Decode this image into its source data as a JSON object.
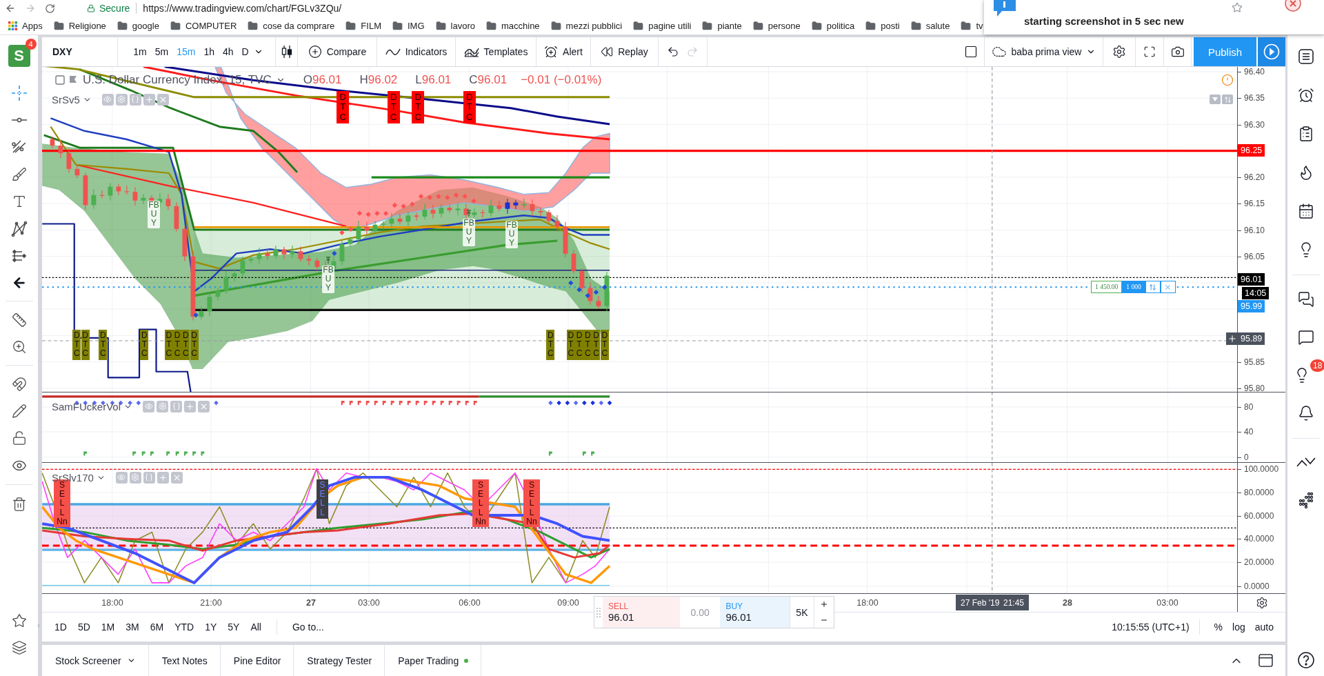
{
  "browser": {
    "secure_label": "Secure",
    "url": "https://www.tradingview.com/chart/FGLv3ZQu/",
    "bookmarks": [
      {
        "label": "Apps",
        "kind": "apps"
      },
      {
        "label": "Religione",
        "kind": "folder"
      },
      {
        "label": "google",
        "kind": "folder"
      },
      {
        "label": "COMPUTER",
        "kind": "folder"
      },
      {
        "label": "cose da comprare",
        "kind": "folder"
      },
      {
        "label": "FILM",
        "kind": "folder"
      },
      {
        "label": "IMG",
        "kind": "folder"
      },
      {
        "label": "lavoro",
        "kind": "folder"
      },
      {
        "label": "macchine",
        "kind": "folder"
      },
      {
        "label": "mezzi pubblici",
        "kind": "folder"
      },
      {
        "label": "pagine utili",
        "kind": "folder"
      },
      {
        "label": "piante",
        "kind": "folder"
      },
      {
        "label": "persone",
        "kind": "folder"
      },
      {
        "label": "politica",
        "kind": "folder"
      },
      {
        "label": "posti",
        "kind": "folder"
      },
      {
        "label": "salute",
        "kind": "folder"
      },
      {
        "label": "tv",
        "kind": "folder"
      }
    ]
  },
  "notification": {
    "text": "starting screenshot in 5 sec new"
  },
  "header": {
    "logo": {
      "letter": "S",
      "badge": "4"
    },
    "symbol": "DXY",
    "intervals": [
      {
        "label": "1m",
        "selected": false
      },
      {
        "label": "5m",
        "selected": false
      },
      {
        "label": "15m",
        "selected": true
      },
      {
        "label": "1h",
        "selected": false
      },
      {
        "label": "4h",
        "selected": false
      },
      {
        "label": "D",
        "selected": false
      }
    ],
    "tools": [
      {
        "label": "Compare",
        "kind": "compare"
      },
      {
        "label": "Indicators",
        "kind": "indicators"
      },
      {
        "label": "Templates",
        "kind": "templates"
      },
      {
        "label": "Alert",
        "kind": "alert"
      },
      {
        "label": "Replay",
        "kind": "replay"
      }
    ],
    "layout_name": "baba prima view",
    "publish": "Publish"
  },
  "main_pane": {
    "title": "U.S. Dollar Currency Index, 15, TVC",
    "ohlc": [
      {
        "key": "O",
        "value": "96.01"
      },
      {
        "key": "H",
        "value": "96.02"
      },
      {
        "key": "L",
        "value": "96.01"
      },
      {
        "key": "C",
        "value": "96.01"
      }
    ],
    "change": "−0.01 (−0.01%)",
    "study": "SrSv5",
    "scale": [
      "96.40",
      "96.35",
      "96.30",
      "96.20",
      "96.15",
      "96.10",
      "96.05",
      "95.85",
      "95.80"
    ],
    "price_tags": [
      {
        "label": "96.25",
        "kind": "level"
      },
      {
        "label": "96.01",
        "kind": "last"
      },
      {
        "label": "14:05",
        "kind": "countdown"
      },
      {
        "label": "95.99",
        "kind": "bid"
      },
      {
        "label": "95.89",
        "kind": "crosshair"
      }
    ],
    "position": {
      "price": "1 450.00",
      "quantity": "1 000"
    },
    "markers": [
      {
        "label": "DTC",
        "kind": "above"
      },
      {
        "label": "DTC",
        "kind": "above"
      },
      {
        "label": "DTC",
        "kind": "above"
      },
      {
        "label": "DTC",
        "kind": "above"
      },
      {
        "label": "DTC",
        "kind": "below"
      },
      {
        "label": "DTC",
        "kind": "below"
      },
      {
        "label": "DTC",
        "kind": "below"
      },
      {
        "label": "DTC",
        "kind": "below"
      },
      {
        "label": "DTC",
        "kind": "below"
      },
      {
        "label": "DTC",
        "kind": "below"
      },
      {
        "label": "DTC",
        "kind": "below"
      },
      {
        "label": "DTC",
        "kind": "below"
      },
      {
        "label": "DTC",
        "kind": "below"
      },
      {
        "label": "DTC",
        "kind": "below"
      },
      {
        "label": "DTC",
        "kind": "below"
      },
      {
        "label": "DTC",
        "kind": "below"
      },
      {
        "label": "DTC",
        "kind": "below"
      },
      {
        "label": "DTC",
        "kind": "below"
      }
    ],
    "buy_labels": [
      {
        "label": "FBUY",
        "arrow": false
      },
      {
        "label": "FBUY",
        "arrow": true
      },
      {
        "label": "FBUY",
        "arrow": true
      },
      {
        "label": "FBUY",
        "arrow": false
      }
    ]
  },
  "volume_pane": {
    "study": "SamFUckerVol",
    "scale": [
      "80",
      "40",
      "0"
    ]
  },
  "oscillator_pane": {
    "study": "SrSlv170",
    "scale": [
      "100.0000",
      "80.0000",
      "60.0000",
      "40.0000",
      "20.0000",
      "0.0000"
    ],
    "markers": [
      {
        "label": "SELL",
        "note": "Nn",
        "kind": "primary"
      },
      {
        "label": "SELL",
        "kind": "secondary"
      },
      {
        "label": "SELL",
        "note": "Nn",
        "kind": "primary"
      },
      {
        "label": "SELL",
        "note": "Nn",
        "kind": "primary"
      }
    ]
  },
  "time_axis": {
    "labels": [
      {
        "label": "18:00",
        "kind": "time"
      },
      {
        "label": "21:00",
        "kind": "time"
      },
      {
        "label": "27",
        "kind": "day"
      },
      {
        "label": "03:00",
        "kind": "time"
      },
      {
        "label": "06:00",
        "kind": "time"
      },
      {
        "label": "09:00",
        "kind": "time"
      },
      {
        "label": "18:00",
        "kind": "time"
      },
      {
        "label": "28",
        "kind": "day"
      },
      {
        "label": "03:00",
        "kind": "time"
      }
    ],
    "crosshair": {
      "date": "27 Feb '19",
      "time": "21:45"
    }
  },
  "order_panel": {
    "sell": {
      "label": "SELL",
      "price": "96.01"
    },
    "spread": "0.00",
    "buy": {
      "label": "BUY",
      "price": "96.01"
    },
    "quantity": "5K"
  },
  "bottom_toolbar": {
    "ranges": [
      "1D",
      "5D",
      "1M",
      "3M",
      "6M",
      "YTD",
      "1Y",
      "5Y",
      "All"
    ],
    "goto": "Go to...",
    "clock": "10:15:55 (UTC+1)",
    "scale_modes": [
      "%",
      "log",
      "auto"
    ]
  },
  "bottom_tabs": [
    {
      "label": "Stock Screener",
      "menu": true,
      "status": false
    },
    {
      "label": "Text Notes",
      "menu": false,
      "status": false
    },
    {
      "label": "Pine Editor",
      "menu": false,
      "status": false
    },
    {
      "label": "Strategy Tester",
      "menu": false,
      "status": false
    },
    {
      "label": "Paper Trading",
      "menu": false,
      "status": true
    }
  ],
  "right_sidebar": {
    "badge": "18"
  }
}
